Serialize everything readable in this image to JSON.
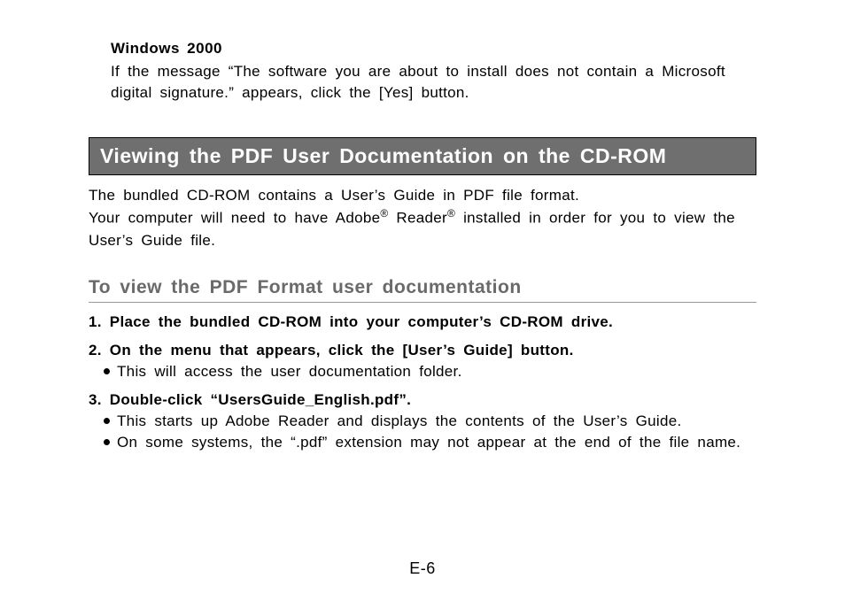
{
  "os_section": {
    "heading": "Windows 2000",
    "instruction": "If the message “The software you are about to install does not contain a Microsoft digital signature.” appears, click the [Yes] button."
  },
  "main_section": {
    "header": "Viewing the PDF User Documentation on the CD-ROM",
    "intro_line1": "The bundled CD-ROM contains a User’s Guide in PDF file format.",
    "intro_line2_before": "Your computer will need to have Adobe",
    "intro_line2_mid": " Reader",
    "intro_line2_after": " installed in order for you to view the User’s Guide file.",
    "reg_symbol": "®"
  },
  "sub_section": {
    "heading": "To view the PDF Format user documentation",
    "steps": [
      {
        "text": "1.  Place the bundled CD-ROM into your computer’s CD-ROM drive.",
        "bullets": []
      },
      {
        "text": "2.  On the menu that appears, click the [User’s Guide] button.",
        "bullets": [
          "This will access the user documentation folder."
        ]
      },
      {
        "text": "3.  Double-click “UsersGuide_English.pdf”.",
        "bullets": [
          "This starts up Adobe Reader and displays the contents of the User’s Guide.",
          "On some systems, the “.pdf” extension may not appear at the end of the file name."
        ]
      }
    ]
  },
  "page_number": "E-6"
}
